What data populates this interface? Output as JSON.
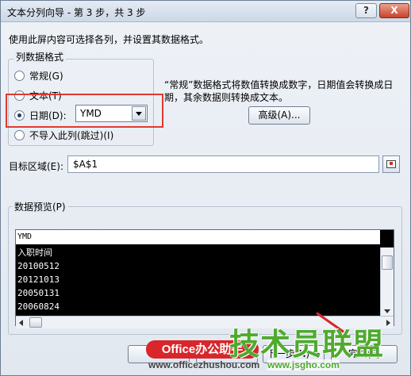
{
  "window": {
    "title": "文本分列向导 - 第 3 步，共 3 步",
    "help_label": "?",
    "close_label": "X"
  },
  "intro": "使用此屏内容可选择各列，并设置其数据格式。",
  "format_group": {
    "legend": "列数据格式",
    "options": [
      {
        "label": "常规(G)",
        "checked": false
      },
      {
        "label": "文本(T)",
        "checked": false
      },
      {
        "label": "日期(D):",
        "checked": true
      },
      {
        "label": "不导入此列(跳过)(I)",
        "checked": false
      }
    ],
    "date_select_value": "YMD"
  },
  "description": "“常规”数据格式将数值转换成数字，日期值会转换成日期，其余数据则转换成文本。",
  "advanced_label": "高级(A)...",
  "destination": {
    "label": "目标区域(E):",
    "value": "$A$1"
  },
  "preview": {
    "legend": "数据预览(P)",
    "column_header": "YMD",
    "rows": [
      "入职时间",
      "20100512",
      "20121013",
      "20050131",
      "20060824"
    ]
  },
  "buttons": {
    "cancel": "取消",
    "back": "< 上一步(B)",
    "next": "下一步(N) >",
    "finish": "完成(F)"
  },
  "watermark": {
    "badge": "Office办公助手",
    "url": "www.officezhushou.com",
    "logo": "技术员联盟",
    "site": "www.jsgho.com"
  }
}
